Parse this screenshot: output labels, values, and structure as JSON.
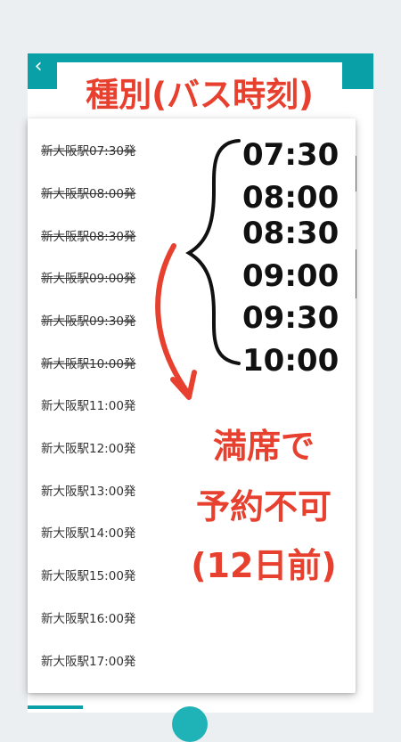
{
  "app": {
    "back_icon": "chevron-left-icon",
    "header_color": "#0aa0a7"
  },
  "annotation": {
    "title": "種別(バス時刻)",
    "accent_color": "#e8402f",
    "times": [
      "07:30",
      "08:00",
      "08:30",
      "09:00",
      "09:30",
      "10:00"
    ],
    "note_lines": [
      "満席で",
      "予約不可",
      "(12日前)"
    ]
  },
  "dropdown": {
    "options": [
      {
        "label": "新大阪駅07:30発",
        "unavailable": true
      },
      {
        "label": "新大阪駅08:00発",
        "unavailable": true
      },
      {
        "label": "新大阪駅08:30発",
        "unavailable": true
      },
      {
        "label": "新大阪駅09:00発",
        "unavailable": true
      },
      {
        "label": "新大阪駅09:30発",
        "unavailable": true
      },
      {
        "label": "新大阪駅10:00発",
        "unavailable": true
      },
      {
        "label": "新大阪駅11:00発",
        "unavailable": false
      },
      {
        "label": "新大阪駅12:00発",
        "unavailable": false
      },
      {
        "label": "新大阪駅13:00発",
        "unavailable": false
      },
      {
        "label": "新大阪駅14:00発",
        "unavailable": false
      },
      {
        "label": "新大阪駅15:00発",
        "unavailable": false
      },
      {
        "label": "新大阪駅16:00発",
        "unavailable": false
      },
      {
        "label": "新大阪駅17:00発",
        "unavailable": false
      }
    ]
  }
}
